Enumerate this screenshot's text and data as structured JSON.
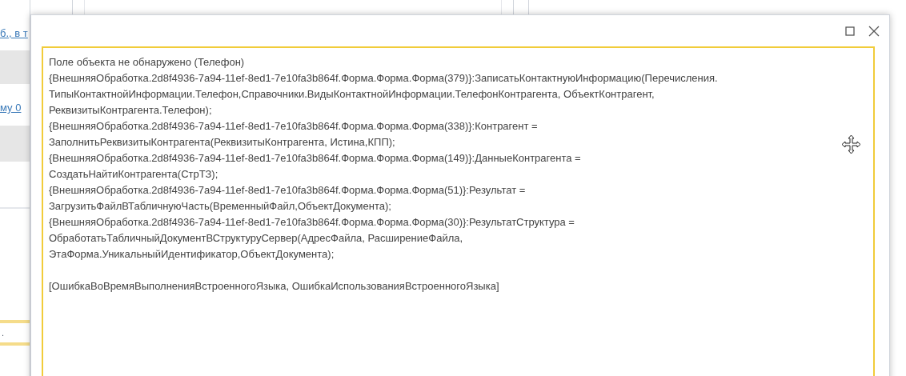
{
  "background": {
    "links": [
      "б., в т",
      "му 0"
    ],
    "field_text": "."
  },
  "dialog": {
    "buttons": [
      {
        "kind": "maximize"
      },
      {
        "kind": "close"
      }
    ],
    "message_lines": [
      "Поле объекта не обнаружено (Телефон)",
      "{ВнешняяОбработка.2d8f4936-7a94-11ef-8ed1-7e10fa3b864f.Форма.Форма.Форма(379)}:ЗаписатьКонтактнуюИнформацию(Перечисления.",
      "ТипыКонтактнойИнформации.Телефон,Справочники.ВидыКонтактнойИнформации.ТелефонКонтрагента, ОбъектКонтрагент,",
      "РеквизитыКонтрагента.Телефон);",
      "{ВнешняяОбработка.2d8f4936-7a94-11ef-8ed1-7e10fa3b864f.Форма.Форма.Форма(338)}:Контрагент =",
      "ЗаполнитьРеквизитыКонтрагента(РеквизитыКонтрагента, Истина,КПП);",
      "{ВнешняяОбработка.2d8f4936-7a94-11ef-8ed1-7e10fa3b864f.Форма.Форма.Форма(149)}:ДанныеКонтрагента =",
      "СоздатьНайтиКонтрагента(СтрТЗ);",
      "{ВнешняяОбработка.2d8f4936-7a94-11ef-8ed1-7e10fa3b864f.Форма.Форма.Форма(51)}:Результат =",
      "ЗагрузитьФайлВТабличнуюЧасть(ВременныйФайл,ОбъектДокумента);",
      "{ВнешняяОбработка.2d8f4936-7a94-11ef-8ed1-7e10fa3b864f.Форма.Форма.Форма(30)}:РезультатСтруктура =",
      "ОбработатьТабличныйДокументВСтруктуруСервер(АдресФайла, РасширениеФайла,",
      "ЭтаФорма.УникальныйИдентификатор,ОбъектДокумента);"
    ],
    "error_categories": "[ОшибкаВоВремяВыполненияВстроенногоЯзыка, ОшибкаИспользованияВстроенногоЯзыка]"
  }
}
